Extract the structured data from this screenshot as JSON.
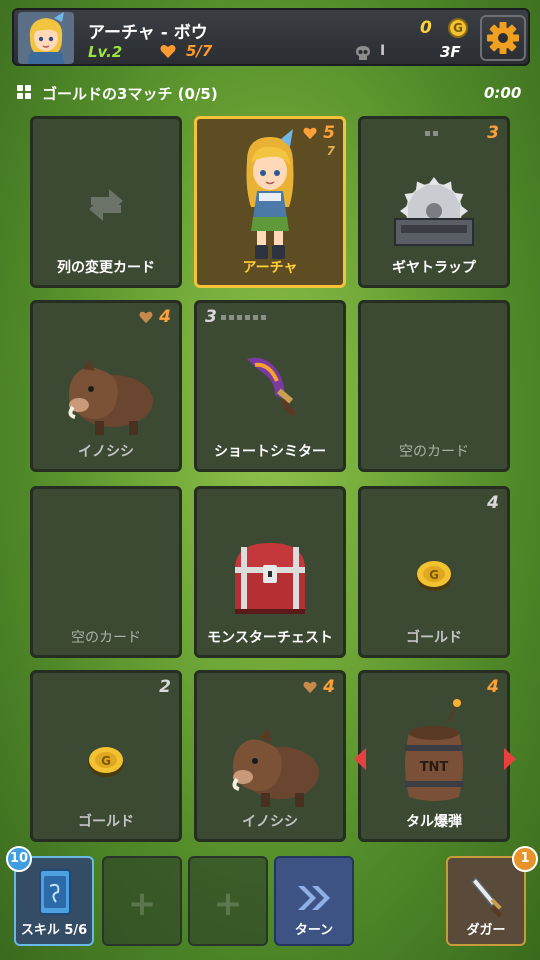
{
  "player": {
    "name": "アーチャ - ボウ",
    "level": "Lv.2",
    "hp": "5/7",
    "gold": "0",
    "gold_symbol": "G",
    "kills": "I",
    "floor": "3F"
  },
  "quest": {
    "text": "ゴールドの3マッチ (0/5)",
    "timer": "0:00"
  },
  "cards": [
    {
      "label": "列の変更カード"
    },
    {
      "label": "アーチャ",
      "hp": "5",
      "armor": "7"
    },
    {
      "label": "ギヤトラップ",
      "count": "3"
    },
    {
      "label": "イノシシ",
      "hp": "4"
    },
    {
      "label": "ショートシミター",
      "count": "3"
    },
    {
      "label": "空のカード"
    },
    {
      "label": "空のカード"
    },
    {
      "label": "モンスターチェスト"
    },
    {
      "label": "ゴールド",
      "count": "4"
    },
    {
      "label": "ゴールド",
      "count": "2"
    },
    {
      "label": "イノシシ",
      "hp": "4"
    },
    {
      "label": "タル爆弾",
      "count": "4"
    }
  ],
  "bottom": {
    "skill_label": "スキル 5/6",
    "skill_badge": "10",
    "plus_symbol": "+",
    "turn_label": "ターン",
    "dagger_label": "ダガー",
    "dagger_badge": "1"
  },
  "colors": {
    "hero_border": "#f5c23a",
    "hp_orange": "#ffa13a",
    "level_green": "#9be33f",
    "gold_yellow": "#ffd23a"
  }
}
